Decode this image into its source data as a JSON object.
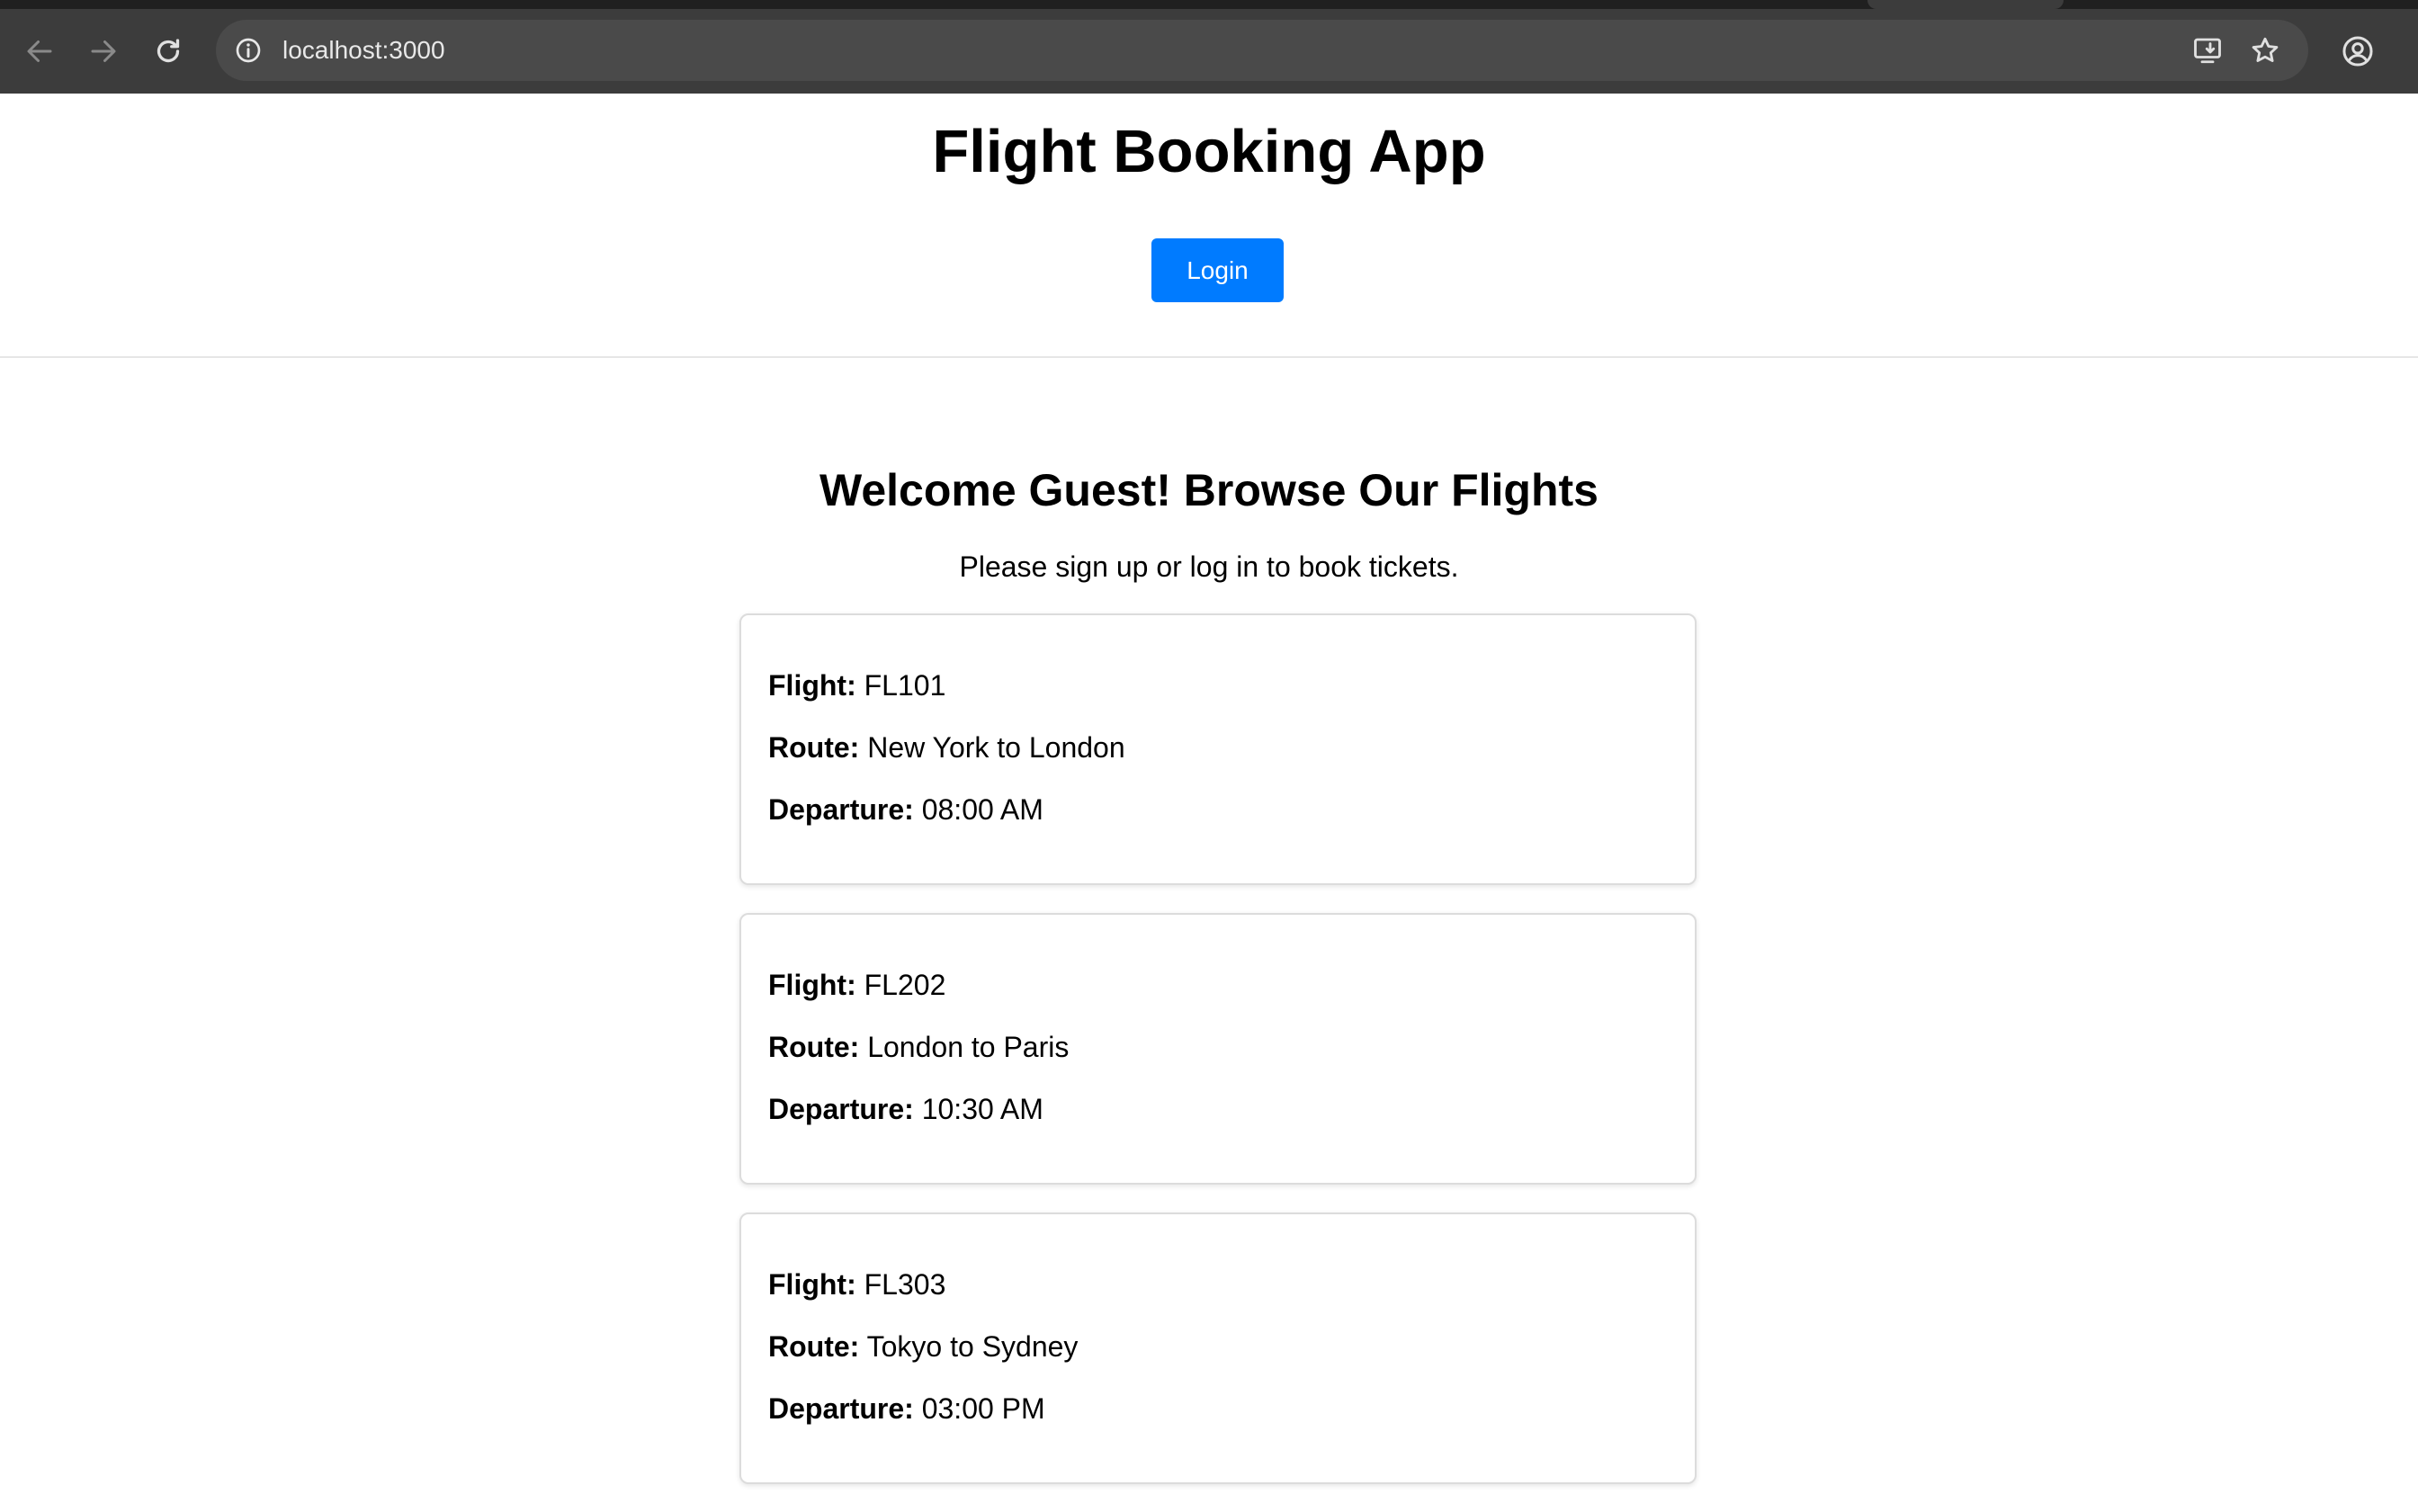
{
  "browser": {
    "url": "localhost:3000",
    "icons": {
      "back": "arrow-left-icon",
      "forward": "arrow-right-icon",
      "reload": "reload-icon",
      "site_info": "info-icon",
      "install": "install-app-icon",
      "bookmark": "star-icon",
      "profile": "profile-icon"
    }
  },
  "header": {
    "title": "Flight Booking App",
    "login_label": "Login"
  },
  "main": {
    "welcome": "Welcome Guest! Browse Our Flights",
    "subtitle": "Please sign up or log in to book tickets.",
    "labels": {
      "flight": "Flight:",
      "route": "Route:",
      "departure": "Departure:"
    },
    "flights": [
      {
        "flight": "FL101",
        "route": "New York to London",
        "departure": "08:00 AM"
      },
      {
        "flight": "FL202",
        "route": "London to Paris",
        "departure": "10:30 AM"
      },
      {
        "flight": "FL303",
        "route": "Tokyo to Sydney",
        "departure": "03:00 PM"
      }
    ]
  },
  "colors": {
    "accent": "#007bff",
    "chrome_bg": "#3c3c3c",
    "omnibox_bg": "#4a4a4a"
  }
}
